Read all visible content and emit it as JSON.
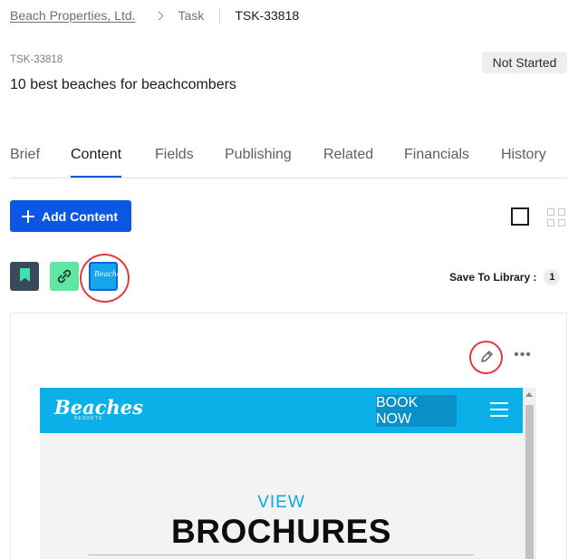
{
  "breadcrumb": {
    "org": "Beach Properties, Ltd.",
    "section": "Task",
    "id": "TSK-33818"
  },
  "header": {
    "code": "TSK-33818",
    "title": "10 best beaches for beachcombers",
    "status": "Not Started"
  },
  "tabs": [
    {
      "label": "Brief"
    },
    {
      "label": "Content",
      "active": true
    },
    {
      "label": "Fields"
    },
    {
      "label": "Publishing"
    },
    {
      "label": "Related"
    },
    {
      "label": "Financials"
    },
    {
      "label": "History"
    }
  ],
  "toolbar": {
    "add_content_label": "Add Content",
    "view_mode": "single"
  },
  "attachments": {
    "items": [
      {
        "icon": "bookmark-icon",
        "color": "#3a4a5c"
      },
      {
        "icon": "link-icon",
        "color": "#5fe6a1"
      },
      {
        "icon": "beaches-thumbnail",
        "color": "#16a4ea",
        "selected": true
      }
    ],
    "save_to_library_label": "Save To Library :",
    "save_to_library_count": "1"
  },
  "preview": {
    "logo": "Beaches",
    "logo_sub": "RESORTS",
    "book_now_label": "BOOK NOW",
    "view_text": "VIEW",
    "headline": "BROCHURES",
    "brand_color": "#0bb0e8"
  },
  "colors": {
    "accent": "#0b57e3",
    "highlight_ring": "#e23a3f"
  }
}
